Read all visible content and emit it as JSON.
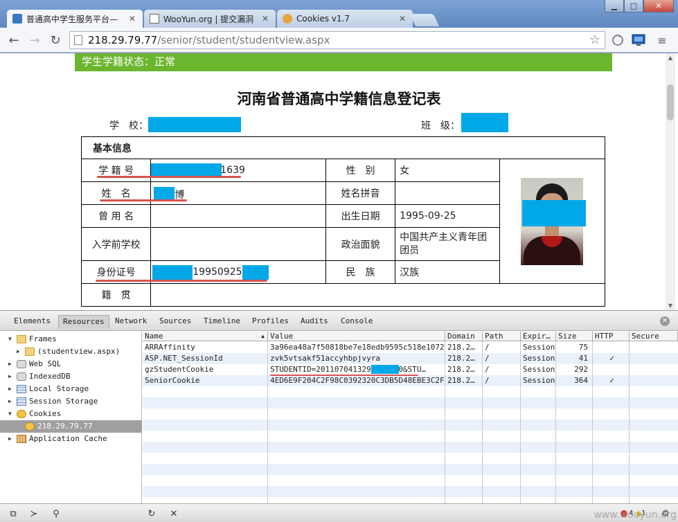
{
  "browser": {
    "tabs": [
      {
        "title": "普通高中学生服务平台—",
        "active": true
      },
      {
        "title": "WooYun.org | 提交漏洞",
        "active": false
      },
      {
        "title": "Cookies v1.7",
        "active": false
      }
    ],
    "url_host": "218.29.79.77",
    "url_path": "/senior/student/studentview.aspx"
  },
  "page": {
    "status_text": "学生学籍状态：正常",
    "form_title": "河南省普通高中学籍信息登记表",
    "school_label": "学　校：",
    "class_label": "班　级：",
    "section_basic": "基本信息",
    "fields": {
      "student_no_label": "学 籍 号",
      "student_no_value": "1639",
      "gender_label": "性　别",
      "gender_value": "女",
      "name_label": "姓　名",
      "name_value": "博",
      "pinyin_label": "姓名拼音",
      "former_name_label": "曾 用 名",
      "birth_label": "出生日期",
      "birth_value": "1995-09-25",
      "prev_school_label": "入学前学校",
      "political_label": "政治面貌",
      "political_value": "中国共产主义青年团团员",
      "id_label": "身份证号",
      "id_value": "19950925",
      "ethnicity_label": "民　族",
      "ethnicity_value": "汉族",
      "origin_label": "籍　贯"
    }
  },
  "devtools": {
    "tabs": [
      "Elements",
      "Resources",
      "Network",
      "Sources",
      "Timeline",
      "Profiles",
      "Audits",
      "Console"
    ],
    "active_tab": "Resources",
    "tree": [
      {
        "label": "Frames",
        "icon": "folder"
      },
      {
        "label": "(studentview.aspx)",
        "icon": "folder"
      },
      {
        "label": "Web SQL",
        "icon": "db"
      },
      {
        "label": "IndexedDB",
        "icon": "db"
      },
      {
        "label": "Local Storage",
        "icon": "grid"
      },
      {
        "label": "Session Storage",
        "icon": "grid"
      },
      {
        "label": "Cookies",
        "icon": "cookie"
      },
      {
        "label": "218.29.79.77",
        "icon": "cookie"
      },
      {
        "label": "Application Cache",
        "icon": "cache"
      }
    ],
    "columns": [
      "Name",
      "Value",
      "Domain",
      "Path",
      "Expir…",
      "Size",
      "HTTP",
      "Secure"
    ],
    "cookies": [
      {
        "name": "ARRAffinity",
        "value": "3a96ea48a7f50818be7e18edb9595c518e10728…",
        "domain": "218.2…",
        "path": "/",
        "expires": "Session",
        "size": "75",
        "http": ""
      },
      {
        "name": "ASP.NET_SessionId",
        "value": "zvk5vtsakf51accyhbpjvyra",
        "domain": "218.2…",
        "path": "/",
        "expires": "Session",
        "size": "41",
        "http": "✓"
      },
      {
        "name": "gzStudentCookie",
        "value": "STUDENTID=2011070413291​9          6700&STU…",
        "domain": "218.2…",
        "path": "/",
        "expires": "Session",
        "size": "292",
        "http": ""
      },
      {
        "name": "SeniorCookie",
        "value": "4ED6E9F204C2F98C0392320C3DB5D48EBE3C2F4…",
        "domain": "218.2…",
        "path": "/",
        "expires": "Session",
        "size": "364",
        "http": "✓"
      }
    ],
    "error_count": "4",
    "warn_count": "1",
    "watermark": "www.wooyun.org"
  }
}
